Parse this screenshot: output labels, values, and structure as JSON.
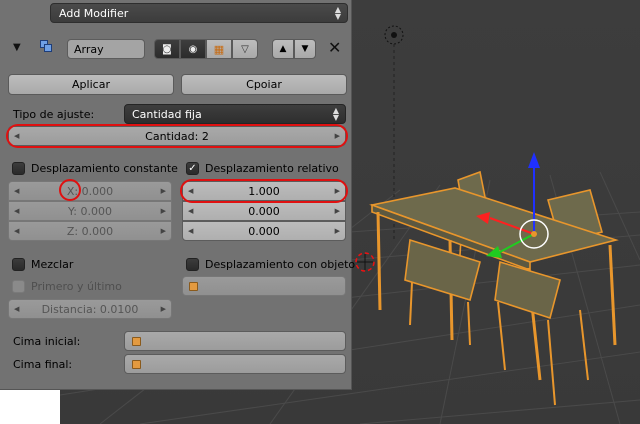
{
  "header": {
    "add_modifier_label": "Add Modifier",
    "modifier_name": "Array",
    "icons": [
      "wrench-icon",
      "render-icon",
      "eye-icon",
      "editmode-icon",
      "cage-icon",
      "move-up-icon",
      "move-down-icon",
      "close-icon"
    ]
  },
  "actions": {
    "apply_label": "Aplicar",
    "copy_label": "Cpoiar"
  },
  "fit": {
    "label": "Tipo de ajuste:",
    "value": "Cantidad fija",
    "count_label": "Cantidad: 2"
  },
  "constant_offset": {
    "label": "Desplazamiento constante",
    "checked": false,
    "x": "X: 0.000",
    "y": "Y: 0.000",
    "z": "Z: 0.000"
  },
  "relative_offset": {
    "label": "Desplazamiento relativo",
    "checked": true,
    "x": "1.000",
    "y": "0.000",
    "z": "0.000"
  },
  "merge": {
    "label": "Mezclar",
    "checked": false,
    "first_last_label": "Primero y último",
    "distance": "Distancia: 0.0100"
  },
  "object_offset": {
    "label": "Desplazamiento con objeto",
    "checked": false
  },
  "caps": {
    "start_label": "Cima inicial:",
    "end_label": "Cima final:"
  },
  "colors": {
    "highlight": "#e01010",
    "panel": "#727272",
    "viewport": "#3b3b3b",
    "selection": "#e8962c"
  }
}
